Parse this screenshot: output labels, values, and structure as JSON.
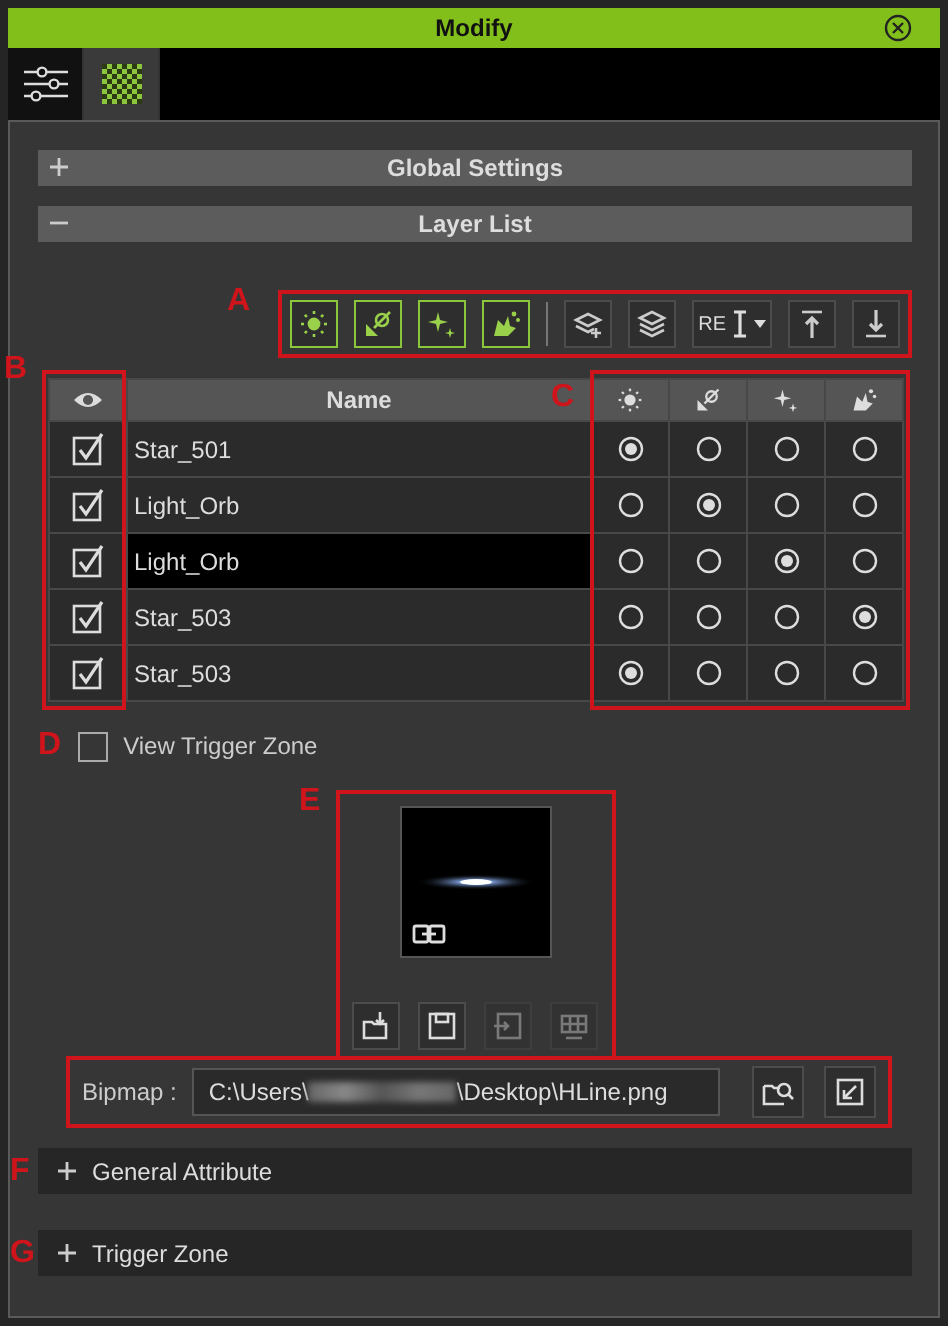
{
  "window": {
    "title": "Modify"
  },
  "tabs": [
    {
      "kind": "sliders",
      "selected": false
    },
    {
      "kind": "checker",
      "selected": true
    }
  ],
  "sections": [
    {
      "title": "Global Settings",
      "expanded": false
    },
    {
      "title": "Layer List",
      "expanded": true
    }
  ],
  "toolbar": {
    "callout": "A",
    "buttons": [
      {
        "kind": "sun",
        "active": true
      },
      {
        "kind": "emitter",
        "active": true
      },
      {
        "kind": "sparkle",
        "active": true
      },
      {
        "kind": "burst",
        "active": true
      },
      {
        "kind": "add-layer",
        "active": false
      },
      {
        "kind": "layers",
        "active": false
      },
      {
        "kind": "rename",
        "active": false,
        "label": "RE"
      },
      {
        "kind": "top",
        "active": false
      },
      {
        "kind": "bottom",
        "active": false
      }
    ]
  },
  "table": {
    "callout_visible": "B",
    "callout_modes": "C",
    "columns": [
      {
        "kind": "eye"
      },
      {
        "kind": "text",
        "label": "Name"
      },
      {
        "kind": "sun"
      },
      {
        "kind": "emitter"
      },
      {
        "kind": "sparkle"
      },
      {
        "kind": "burst"
      }
    ],
    "rows": [
      {
        "name": "Star_501",
        "visible": true,
        "selected": false,
        "modes": [
          {
            "selected": true
          },
          {
            "selected": false
          },
          {
            "selected": false
          },
          {
            "selected": false
          }
        ]
      },
      {
        "name": "Light_Orb",
        "visible": true,
        "selected": false,
        "modes": [
          {
            "selected": false
          },
          {
            "selected": true
          },
          {
            "selected": false
          },
          {
            "selected": false
          }
        ]
      },
      {
        "name": "Light_Orb",
        "visible": true,
        "selected": true,
        "modes": [
          {
            "selected": false
          },
          {
            "selected": false
          },
          {
            "selected": true
          },
          {
            "selected": false
          }
        ]
      },
      {
        "name": "Star_503",
        "visible": true,
        "selected": false,
        "modes": [
          {
            "selected": false
          },
          {
            "selected": false
          },
          {
            "selected": false
          },
          {
            "selected": true
          }
        ]
      },
      {
        "name": "Star_503",
        "visible": true,
        "selected": false,
        "modes": [
          {
            "selected": true
          },
          {
            "selected": false
          },
          {
            "selected": false
          },
          {
            "selected": false
          }
        ]
      }
    ]
  },
  "view_trigger_zone": {
    "callout": "D",
    "label": "View Trigger Zone",
    "checked": false
  },
  "bitmap": {
    "callout": "E",
    "buttons": [
      {
        "kind": "import",
        "disabled": false
      },
      {
        "kind": "save",
        "disabled": false
      },
      {
        "kind": "apply",
        "disabled": true
      },
      {
        "kind": "grid",
        "disabled": true
      }
    ],
    "label": "Bipmap :",
    "path_start": "C:\\Users\\",
    "path_end": "\\Desktop\\HLine.png",
    "actions": [
      {
        "kind": "browse"
      },
      {
        "kind": "reset"
      }
    ]
  },
  "panels": [
    {
      "callout": "F",
      "title": "General Attribute",
      "expanded": false
    },
    {
      "callout": "G",
      "title": "Trigger Zone",
      "expanded": false
    }
  ]
}
